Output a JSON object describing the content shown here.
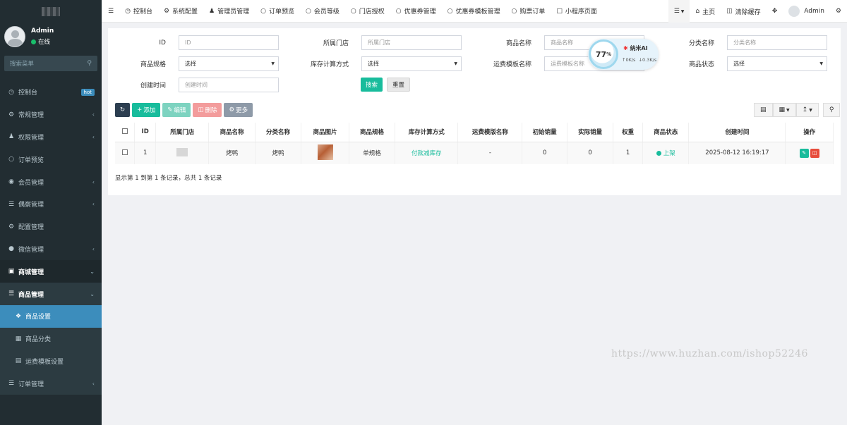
{
  "sidebar": {
    "user": {
      "name": "Admin",
      "status": "在线"
    },
    "search_placeholder": "搜索菜单",
    "items": [
      {
        "label": "控制台",
        "icon": "dashboard-icon",
        "badge": "hot"
      },
      {
        "label": "常规管理",
        "icon": "cogs-icon"
      },
      {
        "label": "权限管理",
        "icon": "group-icon"
      },
      {
        "label": "订单预览",
        "icon": "circle-icon"
      },
      {
        "label": "会员管理",
        "icon": "user-circle-icon"
      },
      {
        "label": "偶察管理",
        "icon": "list-icon"
      },
      {
        "label": "配置管理",
        "icon": "gear-icon"
      },
      {
        "label": "微信管理",
        "icon": "wechat-icon"
      },
      {
        "label": "商城管理",
        "icon": "shop-icon"
      },
      {
        "label": "商品管理",
        "icon": "list-icon"
      },
      {
        "label": "商品设置",
        "icon": "gift-icon"
      },
      {
        "label": "商品分类",
        "icon": "grid-icon"
      },
      {
        "label": "运费模板设置",
        "icon": "truck-icon"
      },
      {
        "label": "订单管理",
        "icon": "list-icon"
      }
    ]
  },
  "topbar": {
    "tabs": [
      {
        "label": "控制台",
        "icon": "dashboard-icon"
      },
      {
        "label": "系统配置",
        "icon": "gear-icon"
      },
      {
        "label": "管理员管理",
        "icon": "user-icon"
      },
      {
        "label": "订单预览",
        "icon": "circle-icon"
      },
      {
        "label": "会员等级",
        "icon": "circle-icon"
      },
      {
        "label": "门店授权",
        "icon": "circle-icon"
      },
      {
        "label": "优惠券管理",
        "icon": "circle-icon"
      },
      {
        "label": "优惠券模板管理",
        "icon": "circle-icon"
      },
      {
        "label": "购票订单",
        "icon": "circle-icon"
      },
      {
        "label": "小程序页面",
        "icon": "bookmark-icon"
      }
    ],
    "home": "主页",
    "clear_cache": "清除缓存",
    "admin": "Admin"
  },
  "filters": {
    "id": {
      "label": "ID",
      "placeholder": "ID"
    },
    "store": {
      "label": "所属门店",
      "placeholder": "所属门店"
    },
    "goods_name": {
      "label": "商品名称",
      "placeholder": "商品名称"
    },
    "category": {
      "label": "分类名称",
      "placeholder": "分类名称"
    },
    "spec": {
      "label": "商品规格",
      "value": "选择"
    },
    "stock_method": {
      "label": "库存计算方式",
      "value": "选择"
    },
    "freight": {
      "label": "运费模板名称",
      "placeholder": "运费模板名称"
    },
    "status": {
      "label": "商品状态",
      "value": "选择"
    },
    "created": {
      "label": "创建时间",
      "placeholder": "创建时间"
    },
    "search_btn": "搜索",
    "reset_btn": "重置"
  },
  "toolbar": {
    "add": "添加",
    "edit": "编辑",
    "delete": "删除",
    "more": "更多"
  },
  "table": {
    "headers": [
      "ID",
      "所属门店",
      "商品名称",
      "分类名称",
      "商品图片",
      "商品规格",
      "库存计算方式",
      "运费模版名称",
      "初始销量",
      "实际销量",
      "权重",
      "商品状态",
      "创建时间",
      "操作"
    ],
    "rows": [
      {
        "id": "1",
        "goods_name": "烤鸭",
        "category": "烤鸭",
        "spec": "单规格",
        "stock_method": "付款减库存",
        "freight": "-",
        "init_sales": "0",
        "real_sales": "0",
        "weight": "1",
        "status": "上架",
        "created": "2025-08-12 16:19:17"
      }
    ],
    "summary": "显示第 1 到第 1 条记录，总共 1 条记录"
  },
  "ai_widget": {
    "percent": "77",
    "unit": "%",
    "name": "纳米AI",
    "up": "0K/s",
    "down": "0.3K/s"
  },
  "watermark": "https://www.huzhan.com/ishop52246",
  "colors": {
    "sidebar_bg": "#222d32",
    "accent": "#3c8dbc",
    "green": "#18bc9c"
  }
}
